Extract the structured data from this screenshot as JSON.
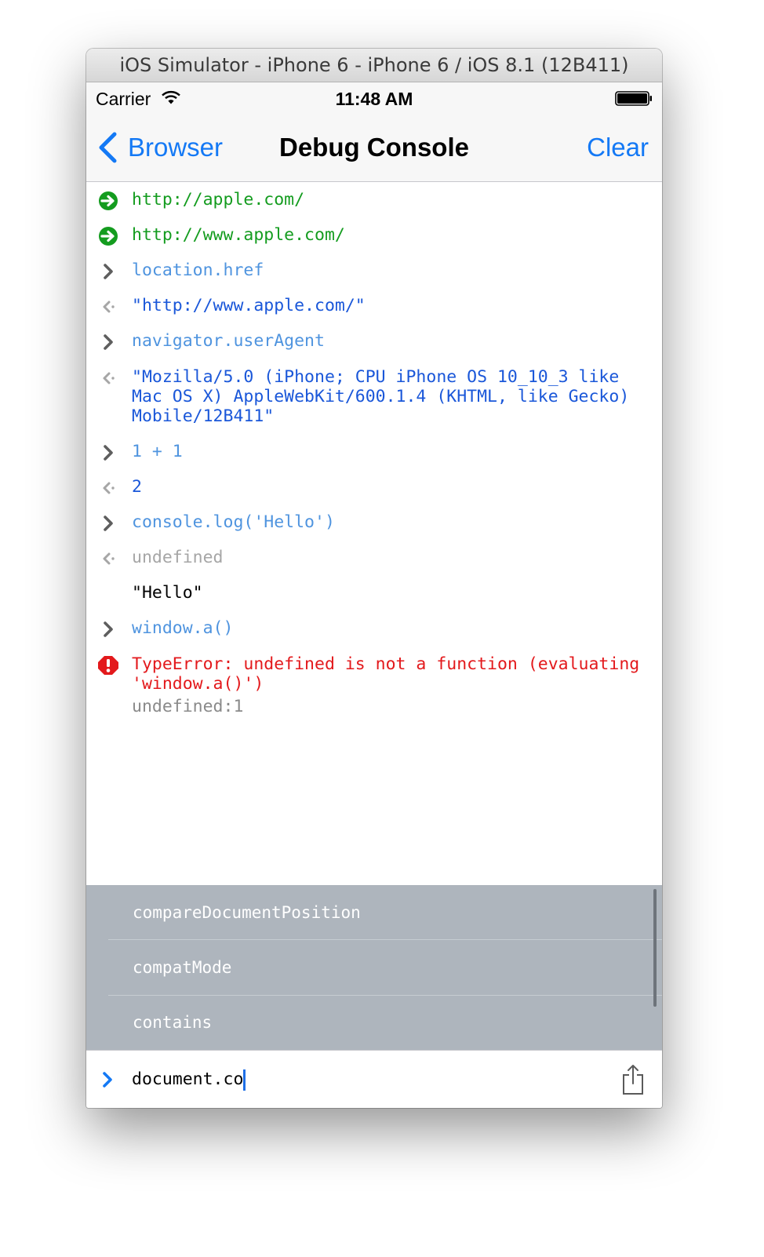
{
  "window": {
    "title": "iOS Simulator - iPhone 6 - iPhone 6 / iOS 8.1 (12B411)"
  },
  "status_bar": {
    "carrier": "Carrier",
    "time": "11:48 AM",
    "icons": [
      "wifi-icon",
      "battery-icon"
    ]
  },
  "nav_bar": {
    "back_label": "Browser",
    "title": "Debug Console",
    "clear_label": "Clear"
  },
  "console": {
    "entries": [
      {
        "kind": "navigation",
        "icon": "arrow-right-circle-icon",
        "text": "http://apple.com/"
      },
      {
        "kind": "navigation",
        "icon": "arrow-right-circle-icon",
        "text": "http://www.apple.com/"
      },
      {
        "kind": "input",
        "icon": "chevron-right-icon",
        "text": "location.href"
      },
      {
        "kind": "result",
        "icon": "chevron-left-icon",
        "text": "\"http://www.apple.com/\""
      },
      {
        "kind": "input",
        "icon": "chevron-right-icon",
        "text": "navigator.userAgent"
      },
      {
        "kind": "result",
        "icon": "chevron-left-icon",
        "text": "\"Mozilla/5.0 (iPhone; CPU iPhone OS 10_10_3 like Mac OS X) AppleWebKit/600.1.4 (KHTML, like Gecko) Mobile/12B411\""
      },
      {
        "kind": "input",
        "icon": "chevron-right-icon",
        "text": "1 + 1"
      },
      {
        "kind": "result",
        "icon": "chevron-left-icon",
        "text": "2"
      },
      {
        "kind": "input",
        "icon": "chevron-right-icon",
        "text": "console.log('Hello')"
      },
      {
        "kind": "result-undefined",
        "icon": "chevron-left-icon",
        "text": "undefined"
      },
      {
        "kind": "log",
        "icon": "",
        "text": "\"Hello\""
      },
      {
        "kind": "input",
        "icon": "chevron-right-icon",
        "text": "window.a()"
      },
      {
        "kind": "error",
        "icon": "error-icon",
        "text": "TypeError: undefined is not a function (evaluating 'window.a()')",
        "source": "undefined:1"
      }
    ]
  },
  "autocomplete": {
    "suggestions": [
      "compareDocumentPosition",
      "compatMode",
      "contains"
    ]
  },
  "input_bar": {
    "value": "document.co",
    "icons": [
      "prompt-chevron-icon",
      "share-icon"
    ]
  },
  "colors": {
    "accent": "#1479f5",
    "navigation": "#149c1f",
    "input": "#4f94df",
    "result": "#1a57d9",
    "undefined": "#a6a6a6",
    "error": "#e3191c",
    "suggestion_bg": "#aeb5bd"
  }
}
